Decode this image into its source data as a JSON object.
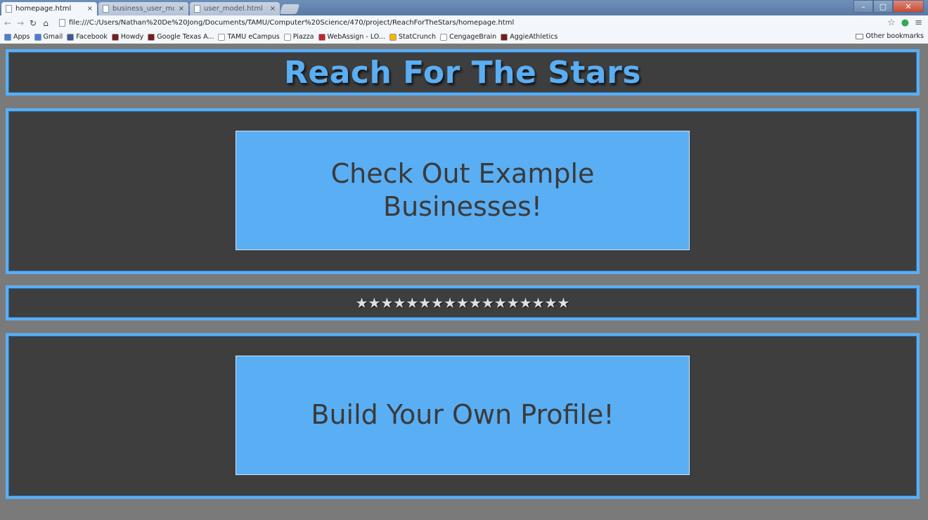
{
  "browser": {
    "tabs": [
      {
        "title": "homepage.html"
      },
      {
        "title": "business_user_model"
      },
      {
        "title": "user_model.html"
      }
    ],
    "close_glyph": "×",
    "url": "file:///C:/Users/Nathan%20De%20Jong/Documents/TAMU/Computer%20Science/470/project/ReachForTheStars/homepage.html",
    "bookmarks": [
      {
        "label": "Apps",
        "color": "#4a7fd6"
      },
      {
        "label": "Gmail",
        "color": "#4a7fd6"
      },
      {
        "label": "Facebook",
        "color": "#3b5998"
      },
      {
        "label": "Howdy",
        "color": "#7a1c1c"
      },
      {
        "label": "Google Texas A...",
        "color": "#7a1c1c"
      },
      {
        "label": "TAMU eCampus",
        "color": "#ffffff"
      },
      {
        "label": "Piazza",
        "color": "#ffffff"
      },
      {
        "label": "WebAssign - LO...",
        "color": "#c8242b"
      },
      {
        "label": "StatCrunch",
        "color": "#f2b705"
      },
      {
        "label": "CengageBrain",
        "color": "#ffffff"
      },
      {
        "label": "AggieAthletics",
        "color": "#7a1c1c"
      }
    ],
    "other_bookmarks": "Other bookmarks"
  },
  "page": {
    "title": "Reach For The Stars",
    "example_button": "Check Out Example Businesses!",
    "divider_stars": "★★★★★★★★★★★★★★★★★",
    "profile_button": "Build Your Own Profile!"
  },
  "colors": {
    "accent": "#5aaef3",
    "panel": "#3e3e3e",
    "background": "#7a7a7a"
  }
}
